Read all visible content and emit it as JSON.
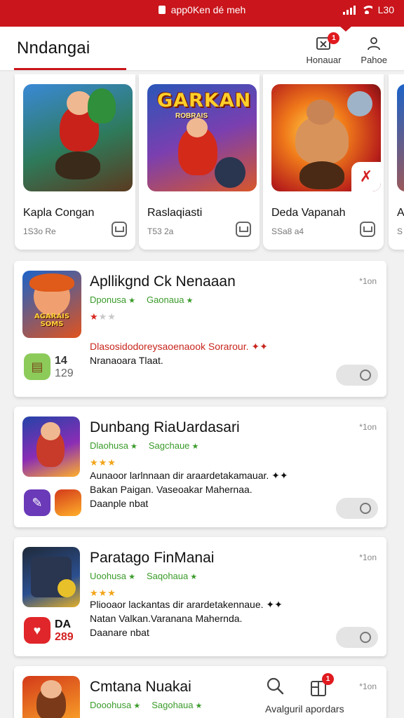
{
  "status_bar": {
    "center_text": "app0Ken dé meh",
    "time": "L30"
  },
  "header": {
    "title": "Nndangai",
    "actions": [
      {
        "label": "Honauar",
        "icon": "inbox-icon",
        "badge": "1"
      },
      {
        "label": "Pahoe",
        "icon": "profile-icon"
      }
    ]
  },
  "featured": [
    {
      "name": "Kapla Congan",
      "meta": "1S3o Re",
      "art": "warrior-hero-art"
    },
    {
      "name": "Raslaqiasti",
      "meta": "T53 2a",
      "logo": "GARKAN",
      "logo_sub": "ROBRAIS",
      "art": "fighter-hero-art"
    },
    {
      "name": "Deda Vapanah",
      "meta": "SSa8 a4",
      "art": "brawler-hero-art"
    },
    {
      "name": "A",
      "meta": "S"
    }
  ],
  "apps": [
    {
      "title": "Apllikgnd Ck Nenaaan",
      "size": "*1on",
      "tags": [
        "Dponusa",
        "Gaonaua"
      ],
      "stars": [
        "red",
        "off",
        "off"
      ],
      "desc_lines": [
        "Dlasosidodoreysaoenaook Sorarour. ✦✦",
        "Nranaoara Tlaat."
      ],
      "badge_icon": "scroll-icon",
      "count_top": "14",
      "count_bottom": "129",
      "icon_caption": "AGARAIS SOMS"
    },
    {
      "title": "Dunbang RiaUardasari",
      "size": "*1on",
      "tags": [
        "Dlaohusa",
        "Sagchaue"
      ],
      "stars": [
        "on",
        "on",
        "on"
      ],
      "desc_lines": [
        "Aunaoor larlnnaan dir araardetakamauar. ✦✦",
        "Bakan Paigan. Vaseoakar Mahernaa.",
        "Daanple nbat"
      ],
      "badge_icon": "pencil-icon"
    },
    {
      "title": "Paratago FinManai",
      "size": "*1on",
      "tags": [
        "Uoohusa",
        "Saqohaua"
      ],
      "stars": [
        "on",
        "on",
        "on"
      ],
      "desc_lines": [
        "Pliooaor lackantas dir arardetakennaue. ✦✦",
        "Natan Valkan.Varanana Mahernda.",
        "Daanare nbat"
      ],
      "badge_icon": "heart-icon",
      "count_top": "DA",
      "count_bottom": "289"
    },
    {
      "title": "Cmtana Nuakai",
      "size": "*1on",
      "tags": [
        "Dooohusa",
        "Sagohaua"
      ]
    }
  ],
  "bottom_nav": {
    "label": "Avalguril apordars",
    "badge": "1"
  }
}
